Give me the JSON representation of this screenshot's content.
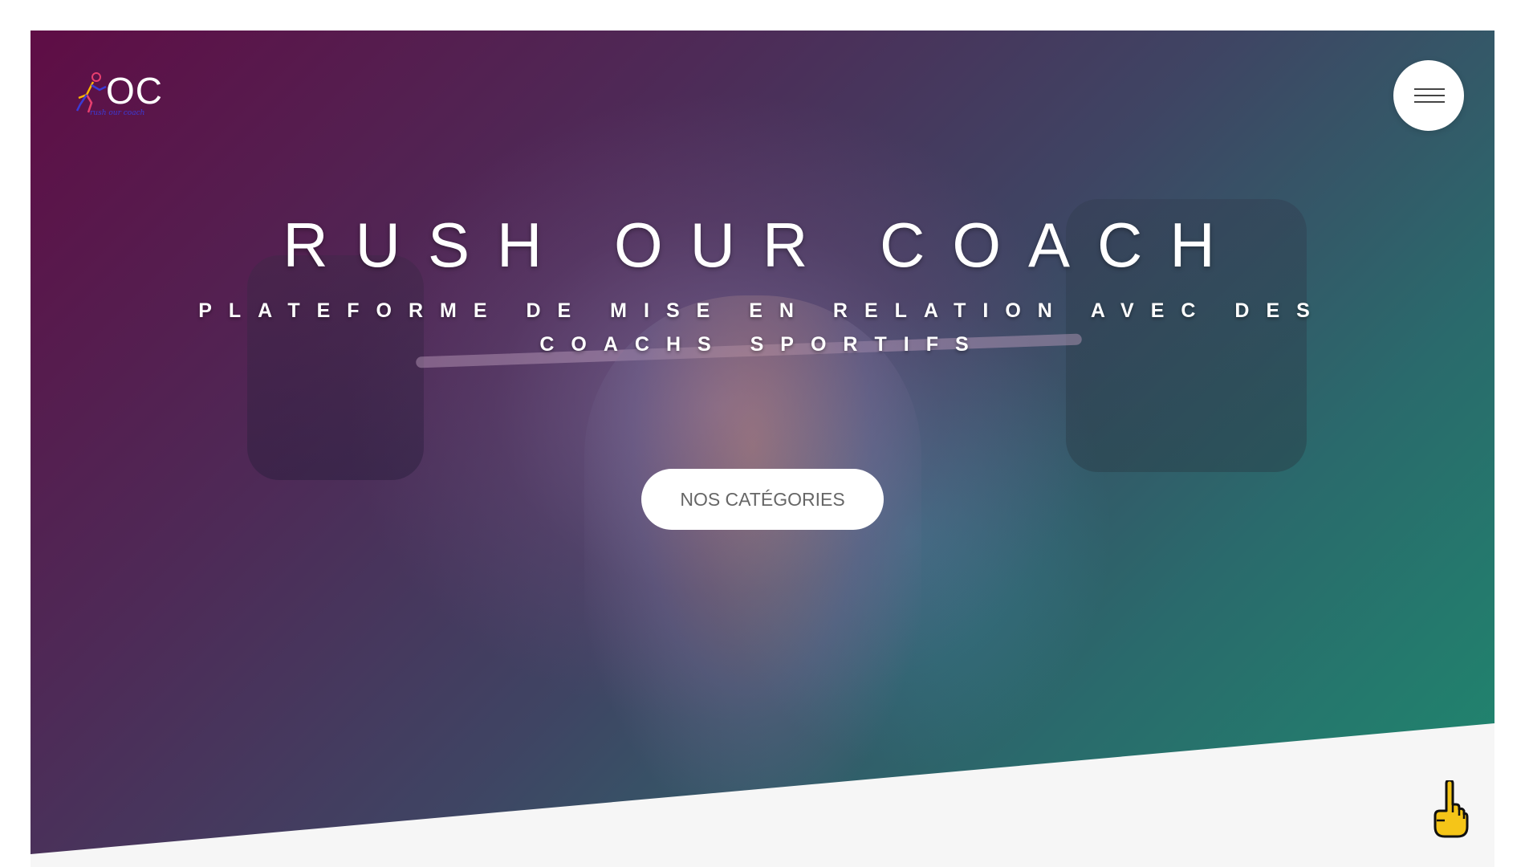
{
  "header": {
    "logo_text": "OC",
    "logo_tagline": "rush our coach",
    "menu_icon": "hamburger-menu-icon"
  },
  "hero": {
    "title": "RUSH OUR COACH",
    "subtitle": "PLATEFORME DE MISE EN RELATION AVEC DES COACHS SPORTIFS",
    "cta_label": "NOS CATÉGORIES",
    "background_image": "weightlifter-squat-photo",
    "gradient_colors": [
      "#5f0d45",
      "#3f4463",
      "#1e8a6e"
    ]
  },
  "floating": {
    "scroll_top_icon": "pointing-up-hand-icon",
    "hand_color": "#f5c518"
  },
  "colors": {
    "page_background": "#ffffff",
    "section_below": "#f6f6f6",
    "button_text": "#666666"
  }
}
